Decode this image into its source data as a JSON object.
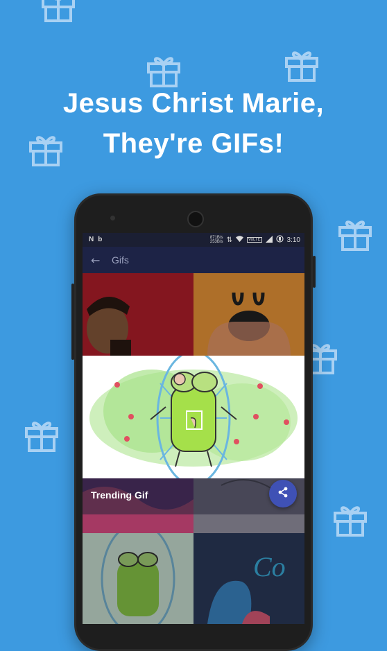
{
  "headline": {
    "line1": "Jesus Christ Marie,",
    "line2": "They're GIFs!"
  },
  "colors": {
    "background": "#3d9ae0",
    "appbar": "#1d2346",
    "share_button": "#3f51b5"
  },
  "status_bar": {
    "left_icons": [
      "N",
      "b"
    ],
    "network_speed_top": "871B/s",
    "network_speed_bottom": "253B/s",
    "volte": "VoLTE",
    "time": "3:10"
  },
  "app_bar": {
    "back_icon": "arrow-left-icon",
    "title": "Gifs"
  },
  "featured_gif": {
    "caption": "Trending Gif",
    "share_icon": "share-icon"
  }
}
